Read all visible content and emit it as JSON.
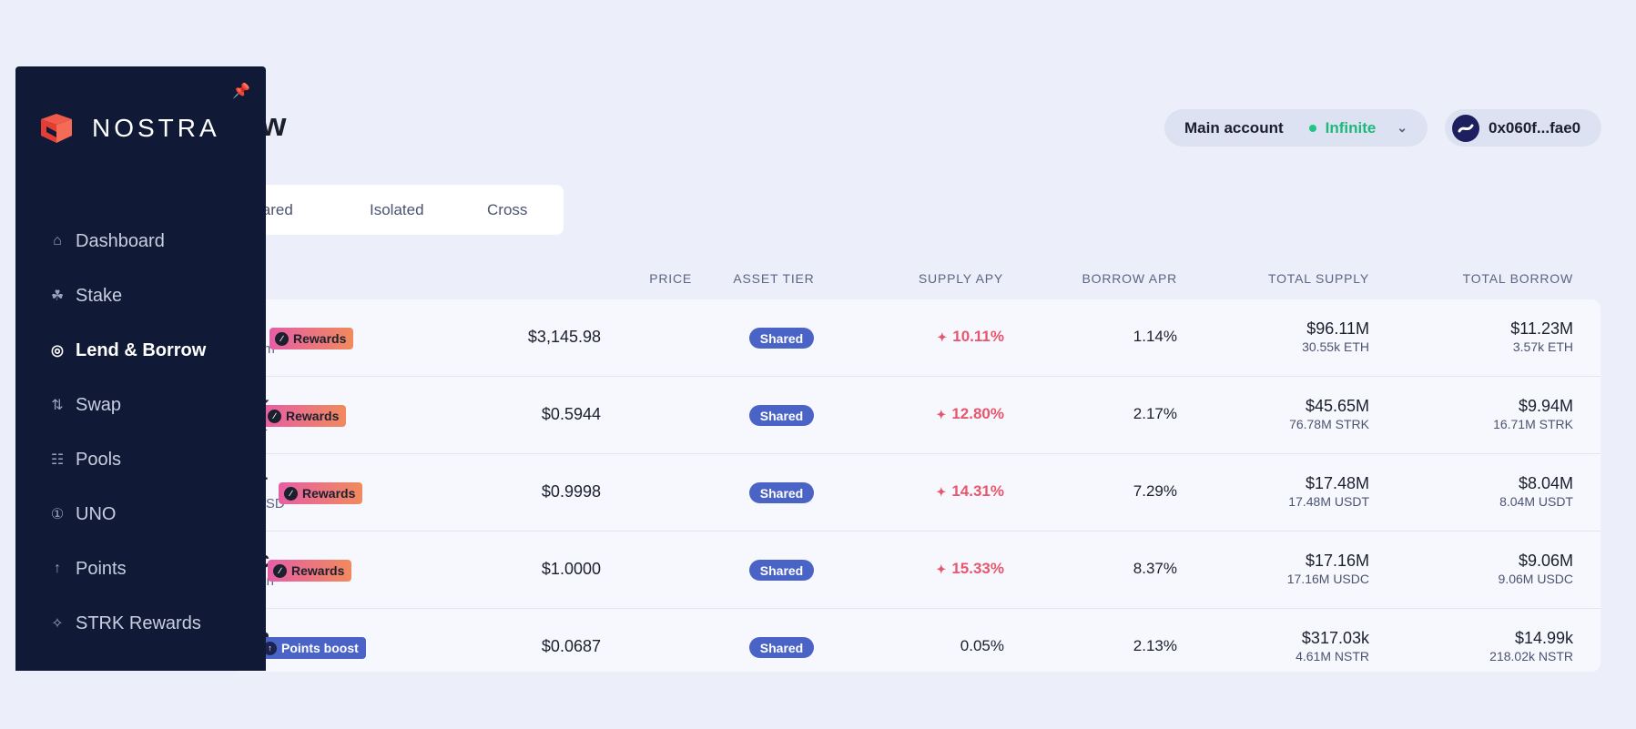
{
  "page": {
    "title": "Borrow"
  },
  "account": {
    "name": "Main account",
    "mode": "Infinite",
    "address": "0x060f...fae0"
  },
  "tabs": [
    "Shared",
    "Isolated",
    "Cross"
  ],
  "columns": {
    "price": "PRICE",
    "tier": "ASSET TIER",
    "supply_apy": "SUPPLY APY",
    "borrow_apr": "BORROW APR",
    "total_supply": "TOTAL SUPPLY",
    "total_borrow": "TOTAL BORROW"
  },
  "rows": [
    {
      "symbol": "",
      "name": "um",
      "badge": "Rewards",
      "badge_type": "rewards",
      "price": "$3,145.98",
      "tier": "Shared",
      "supply_apy": "10.11%",
      "apy_boosted": true,
      "borrow_apr": "1.14%",
      "supply_usd": "$96.11M",
      "supply_amt": "30.55k ETH",
      "borrow_usd": "$11.23M",
      "borrow_amt": "3.57k ETH"
    },
    {
      "symbol": "K",
      "name": "et",
      "badge": "Rewards",
      "badge_type": "rewards",
      "price": "$0.5944",
      "tier": "Shared",
      "supply_apy": "12.80%",
      "apy_boosted": true,
      "borrow_apr": "2.17%",
      "supply_usd": "$45.65M",
      "supply_amt": "76.78M STRK",
      "borrow_usd": "$9.94M",
      "borrow_amt": "16.71M STRK"
    },
    {
      "symbol": "T",
      "name": "USD",
      "badge": "Rewards",
      "badge_type": "rewards",
      "price": "$0.9998",
      "tier": "Shared",
      "supply_apy": "14.31%",
      "apy_boosted": true,
      "borrow_apr": "7.29%",
      "supply_usd": "$17.48M",
      "supply_amt": "17.48M USDT",
      "borrow_usd": "$8.04M",
      "borrow_amt": "8.04M USDT"
    },
    {
      "symbol": "C",
      "name": "oin",
      "badge": "Rewards",
      "badge_type": "rewards",
      "price": "$1.0000",
      "tier": "Shared",
      "supply_apy": "15.33%",
      "apy_boosted": true,
      "borrow_apr": "8.37%",
      "supply_usd": "$17.16M",
      "supply_amt": "17.16M USDC",
      "borrow_usd": "$9.06M",
      "borrow_amt": "9.06M USDC"
    },
    {
      "symbol": "R",
      "name": "",
      "badge": "Points boost",
      "badge_type": "boost",
      "price": "$0.0687",
      "tier": "Shared",
      "supply_apy": "0.05%",
      "apy_boosted": false,
      "borrow_apr": "2.13%",
      "supply_usd": "$317.03k",
      "supply_amt": "4.61M NSTR",
      "borrow_usd": "$14.99k",
      "borrow_amt": "218.02k NSTR"
    }
  ],
  "sidebar": {
    "brand": "NOSTRA",
    "items": [
      {
        "label": "Dashboard",
        "icon": "home-icon"
      },
      {
        "label": "Stake",
        "icon": "sprout-icon"
      },
      {
        "label": "Lend & Borrow",
        "icon": "coins-icon"
      },
      {
        "label": "Swap",
        "icon": "swap-icon"
      },
      {
        "label": "Pools",
        "icon": "pool-icon"
      },
      {
        "label": "UNO",
        "icon": "uno-icon"
      },
      {
        "label": "Points",
        "icon": "arrow-up-icon"
      },
      {
        "label": "STRK Rewards",
        "icon": "rewards-icon"
      }
    ],
    "active_index": 2
  },
  "colors": {
    "sidebar_bg": "#101a36",
    "accent": "#4a63c6",
    "apy": "#e8566e",
    "online": "#1ec783"
  }
}
